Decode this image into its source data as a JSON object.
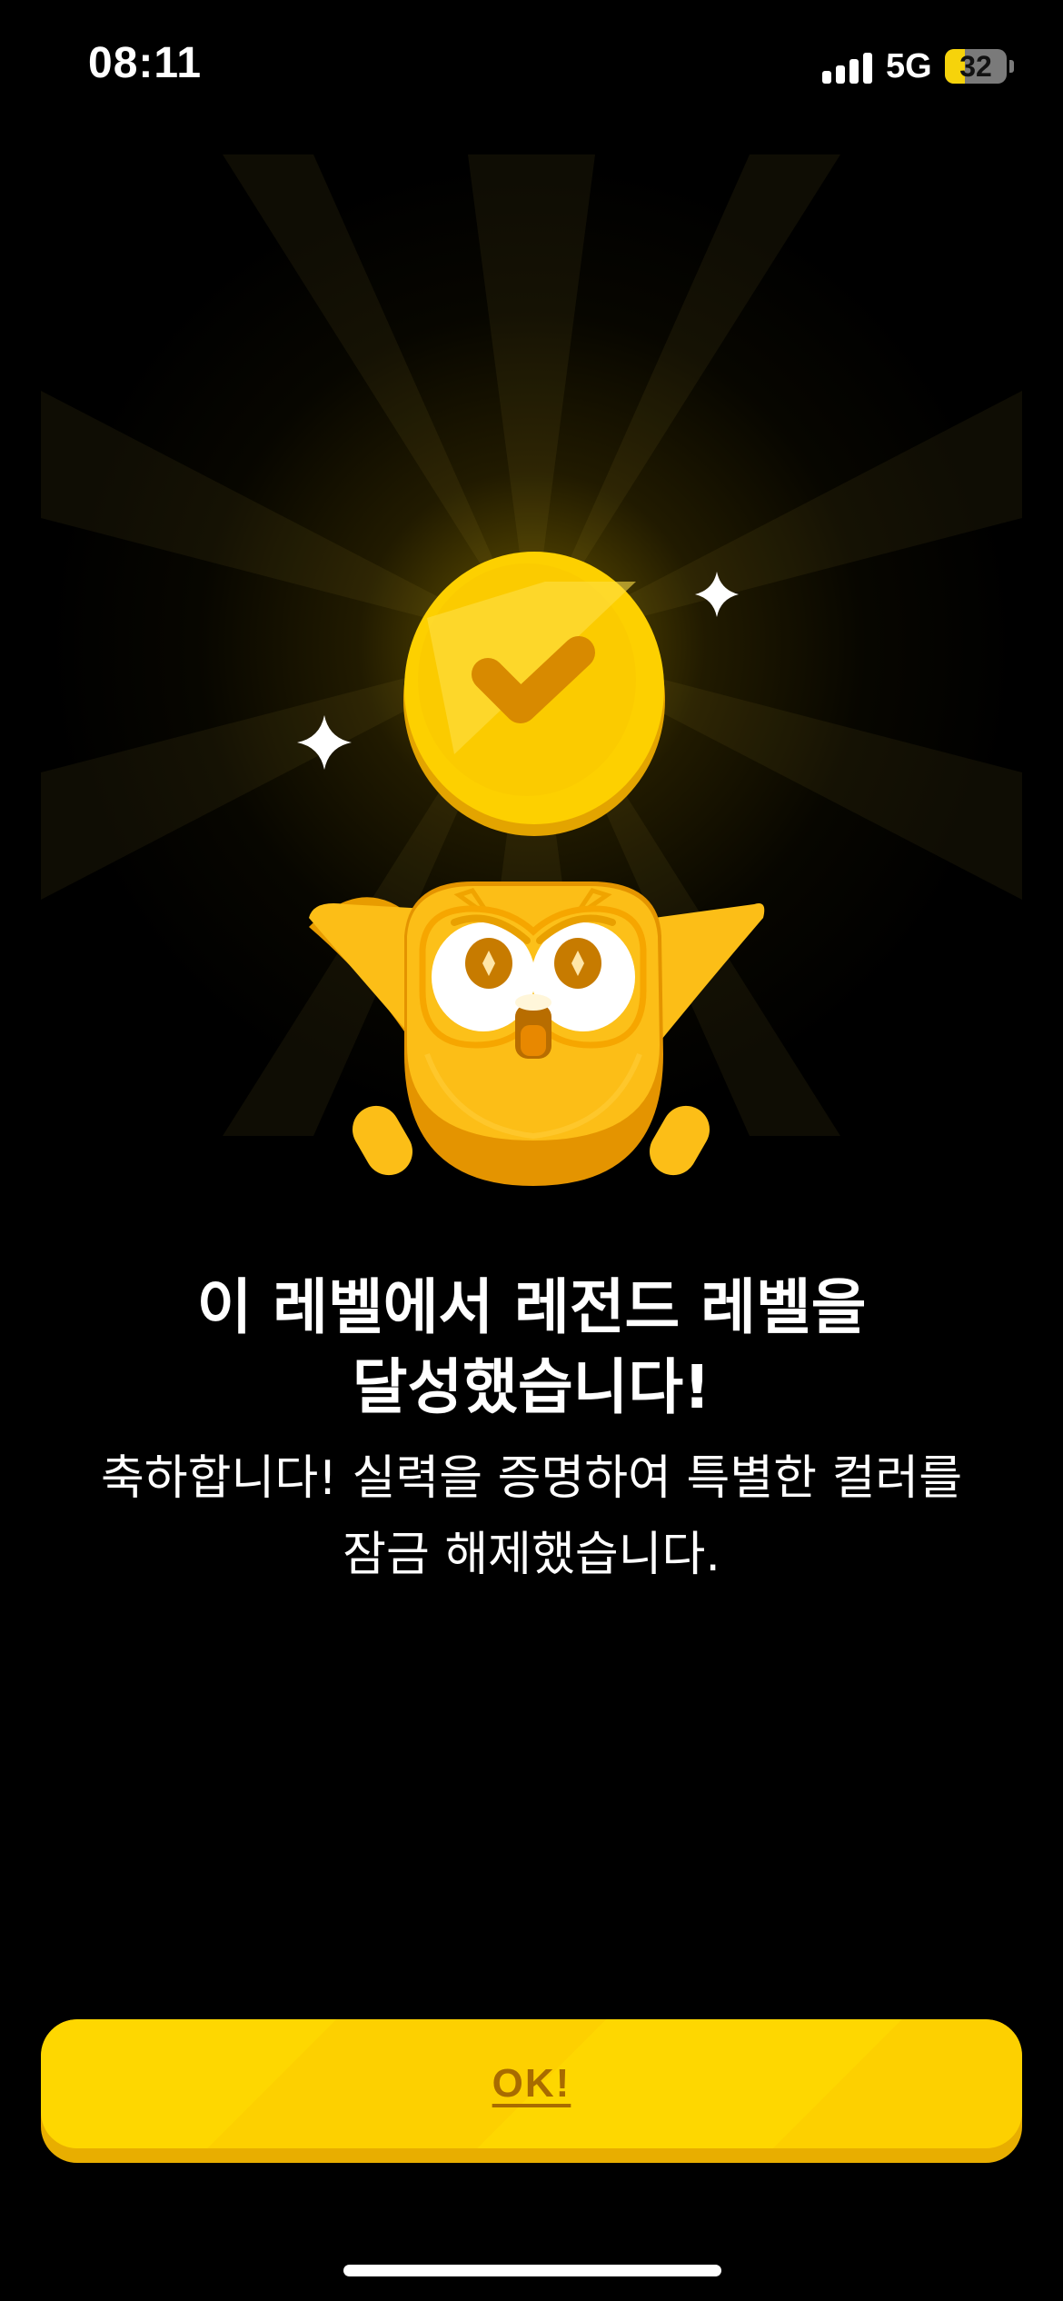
{
  "status_bar": {
    "time": "08:11",
    "network": "5G",
    "battery_level": "32",
    "battery_fraction": 0.32
  },
  "illustration": {
    "icons": [
      "checkmark-coin-icon",
      "sparkle-icon",
      "owl-mascot-icon"
    ],
    "colors": {
      "coin": "#fdd000",
      "owl": "#fbbf18",
      "accent": "#e29000"
    }
  },
  "message": {
    "headline_line1": "이 레벨에서 레전드 레벨을",
    "headline_line2": "달성했습니다!",
    "body_line1": "축하합니다! 실력을 증명하여 특별한 컬러를",
    "body_line2": "잠금 해제했습니다."
  },
  "button": {
    "label": "OK!",
    "color": "#fed700",
    "text_color": "#a86b00"
  }
}
